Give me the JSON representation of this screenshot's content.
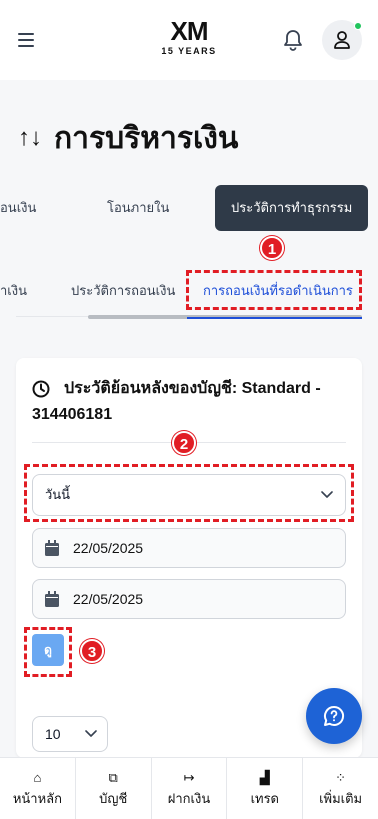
{
  "header": {
    "logo_mark": "XM",
    "logo_sub": "15 YEARS"
  },
  "page": {
    "title_icon": "↑↓",
    "title": "การบริหารเงิน"
  },
  "main_tabs": [
    {
      "label": "อนเงิน",
      "active": false
    },
    {
      "label": "โอนภายใน",
      "active": false
    },
    {
      "label": "ประวัติการทำธุรกรรม",
      "active": true
    }
  ],
  "sub_tabs": [
    {
      "label": "าเงิน",
      "active": false
    },
    {
      "label": "ประวัติการถอนเงิน",
      "active": false
    },
    {
      "label": "การถอนเงินที่รอดำเนินการ",
      "active": true
    }
  ],
  "card": {
    "title": "ประวัติย้อนหลังของบัญชี: Standard - 314406181",
    "period_select": "วันนี้",
    "date_from": "22/05/2025",
    "date_to": "22/05/2025",
    "view_button": "ดู",
    "page_size": "10"
  },
  "annotations": [
    "1",
    "2",
    "3"
  ],
  "bottom_nav": [
    {
      "label": "หน้าหลัก",
      "icon": "home-icon",
      "glyph": "⌂"
    },
    {
      "label": "บัญชี",
      "icon": "wallet-icon",
      "glyph": "⧉"
    },
    {
      "label": "ฝากเงิน",
      "icon": "deposit-icon",
      "glyph": "↦"
    },
    {
      "label": "เทรด",
      "icon": "chart-icon",
      "glyph": "▟"
    },
    {
      "label": "เพิ่มเติม",
      "icon": "grid-icon",
      "glyph": "⁘"
    }
  ],
  "colors": {
    "accent": "#1d4ed8",
    "tab_active_bg": "#2f3a48",
    "annotation": "#e11d24",
    "fab": "#1e63d6"
  }
}
